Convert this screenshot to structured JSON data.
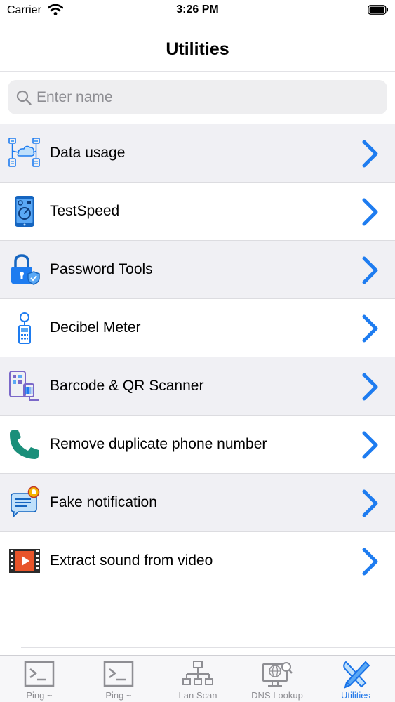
{
  "status_bar": {
    "carrier": "Carrier",
    "time": "3:26 PM"
  },
  "nav": {
    "title": "Utilities"
  },
  "search": {
    "placeholder": "Enter name"
  },
  "items": [
    {
      "label": "Data usage",
      "icon": "network-diagram-icon"
    },
    {
      "label": "TestSpeed",
      "icon": "speedometer-phone-icon"
    },
    {
      "label": "Password Tools",
      "icon": "padlock-icon"
    },
    {
      "label": "Decibel Meter",
      "icon": "decibel-meter-icon"
    },
    {
      "label": "Barcode & QR Scanner",
      "icon": "barcode-scanner-icon"
    },
    {
      "label": "Remove duplicate phone number",
      "icon": "phone-icon"
    },
    {
      "label": "Fake notification",
      "icon": "notification-bell-icon"
    },
    {
      "label": "Extract sound from video",
      "icon": "video-play-icon"
    }
  ],
  "tabs": [
    {
      "label": "Ping ~",
      "icon": "terminal-icon",
      "active": false
    },
    {
      "label": "Ping ~",
      "icon": "terminal-icon",
      "active": false
    },
    {
      "label": "Lan Scan",
      "icon": "lan-network-icon",
      "active": false
    },
    {
      "label": "DNS Lookup",
      "icon": "dns-lookup-icon",
      "active": false
    },
    {
      "label": "Utilities",
      "icon": "tools-icon",
      "active": true
    }
  ],
  "colors": {
    "accent": "#1a73e8",
    "chevron": "#1e7cf0",
    "row_alt": "#f0f0f4",
    "inactive_tab": "#8e8e93"
  }
}
